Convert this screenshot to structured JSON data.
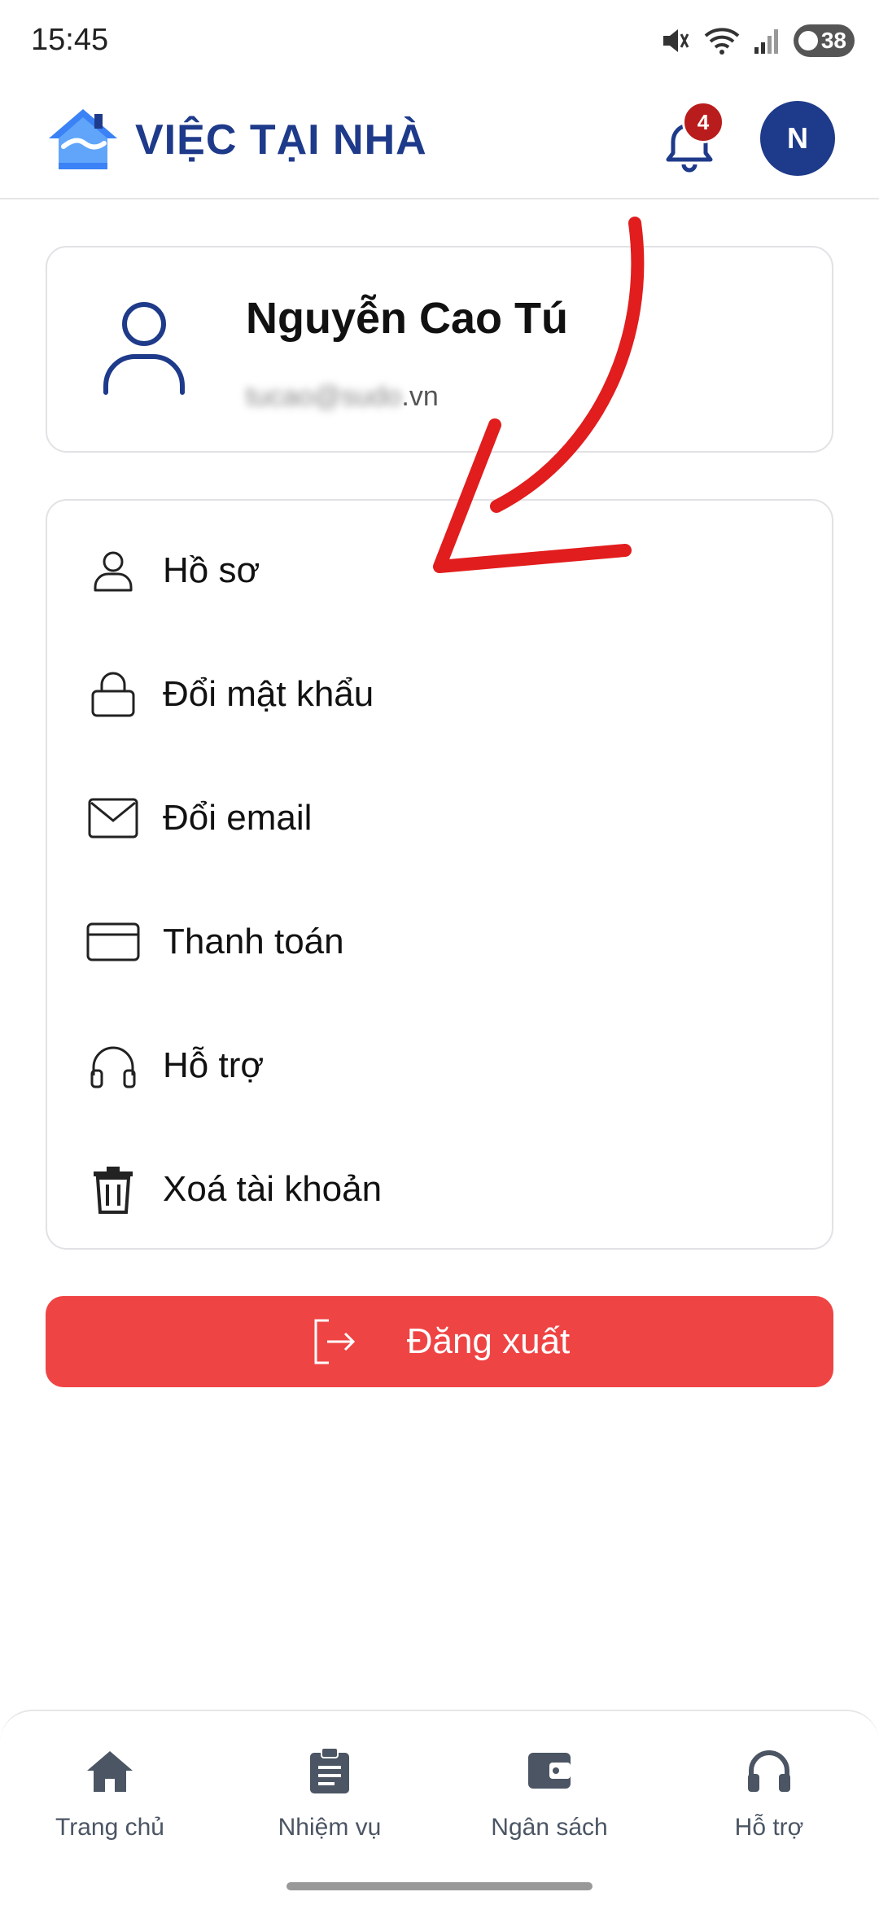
{
  "status_bar": {
    "time": "15:45",
    "battery": "38",
    "icons": [
      "mute-icon",
      "wifi-icon",
      "signal-icon",
      "battery-icon"
    ]
  },
  "header": {
    "title": "VIỆC TẠI NHÀ",
    "notification_count": "4",
    "avatar_initial": "N"
  },
  "profile": {
    "name": "Nguyễn Cao Tú",
    "email_blurred": "tucao@sudo",
    "email_suffix": ".vn"
  },
  "menu": {
    "items": [
      {
        "label": "Hồ sơ",
        "icon": "user-icon"
      },
      {
        "label": "Đổi mật khẩu",
        "icon": "lock-icon"
      },
      {
        "label": "Đổi email",
        "icon": "mail-icon"
      },
      {
        "label": "Thanh toán",
        "icon": "card-icon"
      },
      {
        "label": "Hỗ trợ",
        "icon": "headphones-icon"
      },
      {
        "label": "Xoá tài khoản",
        "icon": "trash-icon"
      }
    ]
  },
  "logout": {
    "label": "Đăng xuất"
  },
  "bottom_nav": {
    "items": [
      {
        "label": "Trang chủ",
        "icon": "home-icon"
      },
      {
        "label": "Nhiệm vụ",
        "icon": "clipboard-icon"
      },
      {
        "label": "Ngân sách",
        "icon": "wallet-icon"
      },
      {
        "label": "Hỗ trợ",
        "icon": "headphones-icon"
      }
    ]
  },
  "colors": {
    "brand": "#1e3a8a",
    "danger": "#ef4444",
    "badge": "#b91c1c",
    "annotation": "#e11d1d"
  }
}
